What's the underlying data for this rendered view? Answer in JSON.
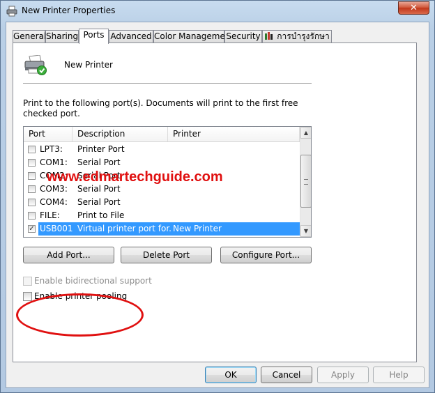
{
  "window": {
    "title": "New Printer Properties",
    "close_glyph": "✕"
  },
  "tabs": [
    {
      "label": "General"
    },
    {
      "label": "Sharing"
    },
    {
      "label": "Ports"
    },
    {
      "label": "Advanced"
    },
    {
      "label": "Color Management"
    },
    {
      "label": "Security"
    },
    {
      "label": "การบำรุงรักษา"
    }
  ],
  "printer": {
    "name": "New Printer"
  },
  "description": "Print to the following port(s). Documents will print to the first free checked port.",
  "ports": {
    "columns": {
      "port": "Port",
      "description": "Description",
      "printer": "Printer"
    },
    "rows": [
      {
        "checked": false,
        "port": "LPT3:",
        "description": "Printer Port",
        "printer": ""
      },
      {
        "checked": false,
        "port": "COM1:",
        "description": "Serial Port",
        "printer": ""
      },
      {
        "checked": false,
        "port": "COM2:",
        "description": "Serial Port",
        "printer": ""
      },
      {
        "checked": false,
        "port": "COM3:",
        "description": "Serial Port",
        "printer": ""
      },
      {
        "checked": false,
        "port": "COM4:",
        "description": "Serial Port",
        "printer": ""
      },
      {
        "checked": false,
        "port": "FILE:",
        "description": "Print to File",
        "printer": ""
      },
      {
        "checked": true,
        "port": "USB001",
        "description": "Virtual printer port for...",
        "printer": "New Printer"
      }
    ],
    "check_glyph": "✓"
  },
  "watermark": "www.edmartechguide.com",
  "buttons": {
    "add_port": "Add Port...",
    "delete_port": "Delete Port",
    "configure_port": "Configure Port...",
    "ok": "OK",
    "cancel": "Cancel",
    "apply": "Apply",
    "help": "Help"
  },
  "options": {
    "bidirectional": "Enable bidirectional support",
    "pooling": "Enable printer pooling"
  },
  "colors": {
    "selection": "#3399ff",
    "watermark": "#e01010",
    "annotation": "#e01010"
  }
}
